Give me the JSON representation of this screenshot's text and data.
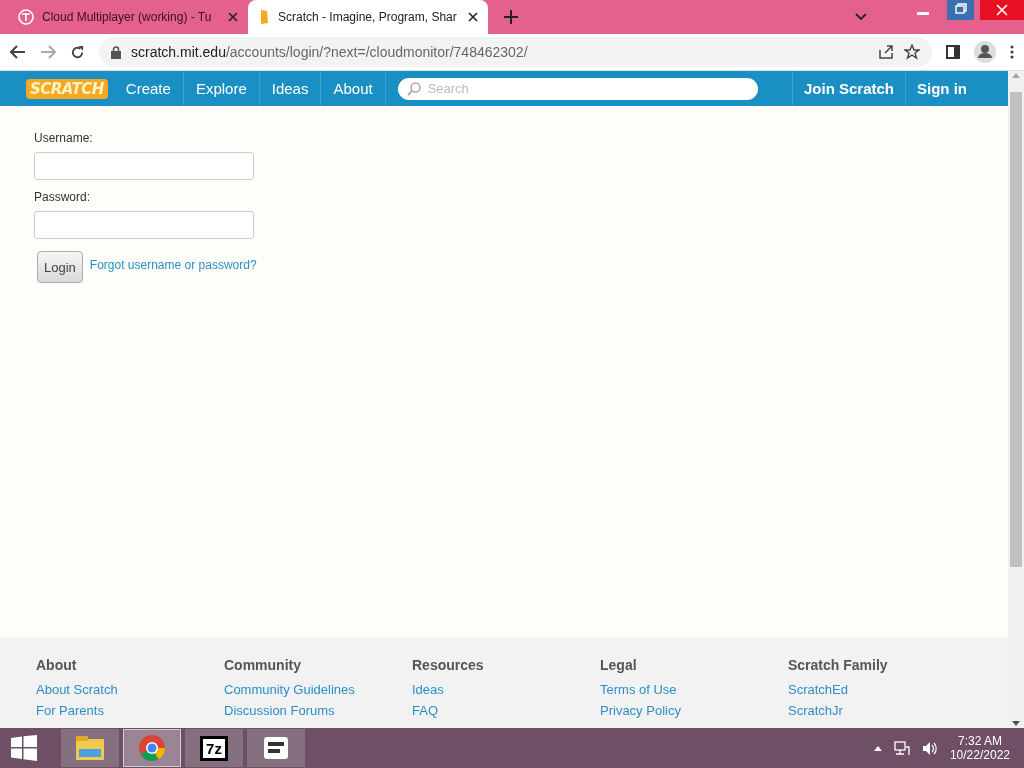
{
  "browser": {
    "tabs": [
      {
        "title": "Cloud Multiplayer (working) - Tu",
        "selected": false
      },
      {
        "title": "Scratch - Imagine, Program, Shar",
        "selected": true
      }
    ],
    "address": {
      "domain": "scratch.mit.edu",
      "path": "/accounts/login/?next=/cloudmonitor/748462302/"
    }
  },
  "nav": {
    "logo": "SCRATCH",
    "links": [
      "Create",
      "Explore",
      "Ideas",
      "About"
    ],
    "search": {
      "placeholder": "Search"
    },
    "actions": [
      "Join Scratch",
      "Sign in"
    ]
  },
  "login": {
    "username_label": "Username:",
    "password_label": "Password:",
    "button": "Login",
    "forgot": "Forgot username or password?"
  },
  "footer": [
    {
      "heading": "About",
      "links": [
        "About Scratch",
        "For Parents"
      ]
    },
    {
      "heading": "Community",
      "links": [
        "Community Guidelines",
        "Discussion Forums"
      ]
    },
    {
      "heading": "Resources",
      "links": [
        "Ideas",
        "FAQ"
      ]
    },
    {
      "heading": "Legal",
      "links": [
        "Terms of Use",
        "Privacy Policy"
      ]
    },
    {
      "heading": "Scratch Family",
      "links": [
        "ScratchEd",
        "ScratchJr"
      ]
    }
  ],
  "taskbar": {
    "apps": [
      {
        "kind": "explorer",
        "selected": false
      },
      {
        "kind": "chrome",
        "selected": true
      },
      {
        "kind": "sevenzip",
        "selected": false
      },
      {
        "kind": "terminal",
        "selected": false
      }
    ],
    "sevenzip_label": "7z",
    "time": "7:32 AM",
    "date": "10/22/2022"
  }
}
